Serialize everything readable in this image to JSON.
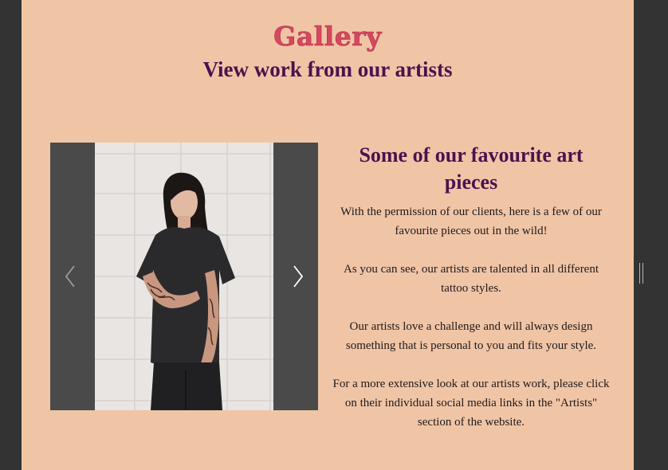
{
  "gallery": {
    "title": "Gallery",
    "subtitle": "View work from our artists"
  },
  "carousel": {
    "prev_icon": "chevron-left-icon",
    "next_icon": "chevron-right-icon",
    "image_subject": "woman-with-tattooed-arms-photo"
  },
  "info": {
    "heading": "Some of our favourite art pieces",
    "paragraphs": [
      "With the permission of our clients, here is a few of our favourite pieces out in the wild!",
      "As you can see, our artists are talented in all different tattoo styles.",
      "Our artists love a challenge and will always design something that is personal to you and fits your style.",
      "For a more extensive look at our artists work, please click on their individual social media links in the \"Artists\" section of the website."
    ]
  },
  "colors": {
    "page_background": "#f0c5a6",
    "outer_background": "#333333",
    "title_color": "#d5485f",
    "subtitle_color": "#4a124f",
    "body_text": "#1f1a1a"
  }
}
